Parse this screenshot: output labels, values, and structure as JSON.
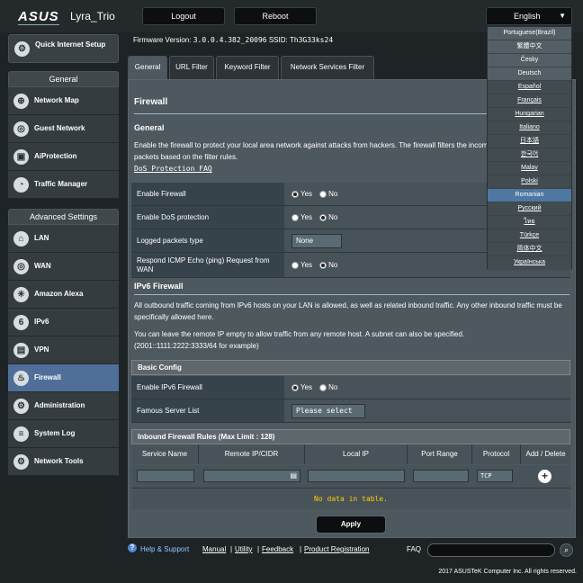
{
  "header": {
    "brand": "ASUS",
    "model": "Lyra_Trio",
    "logout_label": "Logout",
    "reboot_label": "Reboot",
    "language_selected": "English"
  },
  "sidebar": {
    "quick_setup": "Quick Internet Setup",
    "general_heading": "General",
    "general_items": [
      {
        "label": "Network Map",
        "icon": "network-map-icon"
      },
      {
        "label": "Guest Network",
        "icon": "globe-icon"
      },
      {
        "label": "AiProtection",
        "icon": "lock-icon"
      },
      {
        "label": "Traffic Manager",
        "icon": "gauge-icon"
      }
    ],
    "advanced_heading": "Advanced Settings",
    "advanced_items": [
      {
        "label": "LAN",
        "icon": "home-icon"
      },
      {
        "label": "WAN",
        "icon": "globe-icon"
      },
      {
        "label": "Amazon Alexa",
        "icon": "voice-icon"
      },
      {
        "label": "IPv6",
        "icon": "ipv6-icon"
      },
      {
        "label": "VPN",
        "icon": "vpn-icon"
      },
      {
        "label": "Firewall",
        "icon": "flame-icon"
      },
      {
        "label": "Administration",
        "icon": "gear-icon"
      },
      {
        "label": "System Log",
        "icon": "log-icon"
      },
      {
        "label": "Network Tools",
        "icon": "tools-icon"
      }
    ]
  },
  "firmware": {
    "label": "Firmware Version:",
    "version": "3.0.0.4.382_20096",
    "ssid_label": "SSID:",
    "ssid": "Th3G33ks24"
  },
  "tabs": [
    "General",
    "URL Filter",
    "Keyword Filter",
    "Network Services Filter"
  ],
  "firewall": {
    "title": "Firewall",
    "general_heading": "General",
    "description": "Enable the firewall to protect your local area network against attacks from hackers. The firewall filters the incoming and outgoing packets based on the filter rules.",
    "dos_faq": "DoS Protection FAQ",
    "enable_firewall_label": "Enable Firewall",
    "dos_label": "Enable DoS protection",
    "logged_label": "Logged packets type",
    "logged_value": "None",
    "icmp_label": "Respond ICMP Echo (ping) Request from WAN",
    "yes": "Yes",
    "no": "No"
  },
  "ipv6": {
    "title": "IPv6 Firewall",
    "para1": "All outbound traffic coming from IPv6 hosts on your LAN is allowed, as well as related inbound traffic. Any other inbound traffic must be specifically allowed here.",
    "para2": "You can leave the remote IP empty to allow traffic from any remote host. A subnet can also be specified.",
    "para2_example": "(2001::1111:2222:3333/64 for example)",
    "basic_config": "Basic Config",
    "enable_label": "Enable IPv6 Firewall",
    "famous_label": "Famous Server List",
    "famous_value": "Please select",
    "rules_heading": "Inbound Firewall Rules (Max Limit : 128)",
    "columns": [
      "Service Name",
      "Remote IP/CIDR",
      "Local IP",
      "Port Range",
      "Protocol",
      "Add / Delete"
    ],
    "protocol_value": "TCP",
    "no_data": "No data in table."
  },
  "apply_label": "Apply",
  "footer": {
    "help": "Help & Support",
    "manual": "Manual",
    "utility": "Utility",
    "feedback": "Feedback",
    "registration": "Product Registration",
    "faq": "FAQ",
    "copyright": "2017 ASUSTeK Computer Inc. All rights reserved."
  },
  "languages": [
    "Portuguese(Brazil)",
    "繁體中文",
    "Česky",
    "Deutsch",
    "Español",
    "Français",
    "Hungarian",
    "Italiano",
    "日本語",
    "한국어",
    "Malay",
    "Polski",
    "Romanian",
    "Русский",
    "ไทย",
    "Türkçe",
    "简体中文",
    "Українська"
  ],
  "languages_highlighted": "Romanian",
  "colors": {
    "background": "#1e2326",
    "panel": "#4d595e",
    "active_nav": "#4f6f98",
    "no_data_text": "#ffcc00"
  }
}
